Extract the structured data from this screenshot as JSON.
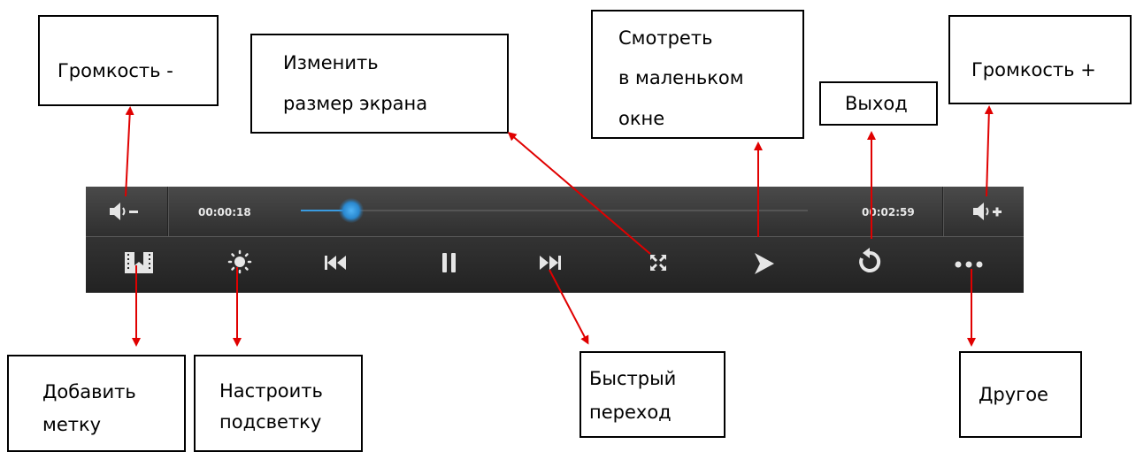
{
  "callouts": {
    "volume_down": "Громкость -",
    "resize_line1": "Изменить",
    "resize_line2": "размер экрана",
    "small_window_line1": "Смотреть",
    "small_window_line2": "в маленьком",
    "small_window_line3": "окне",
    "volume_up": "Громкость +",
    "exit": "Выход",
    "add_mark_line1": "Добавить",
    "add_mark_line2": "метку",
    "backlight_line1": "Настроить",
    "backlight_line2": "подсветку",
    "fast_line1": "Быстрый",
    "fast_line2": "переход",
    "other": "Другое"
  },
  "player": {
    "elapsed_time": "00:00:18",
    "total_time": "00:02:59",
    "progress_fraction": 0.1
  },
  "icons": [
    "volume-down-icon",
    "volume-up-icon",
    "bookmark-icon",
    "brightness-icon",
    "previous-icon",
    "pause-icon",
    "next-icon",
    "fullscreen-icon",
    "small-window-icon",
    "exit-icon",
    "more-icon"
  ],
  "colors": {
    "arrow": "#e00000",
    "progress": "#3a9be0",
    "bar": "#2f2f2f"
  }
}
